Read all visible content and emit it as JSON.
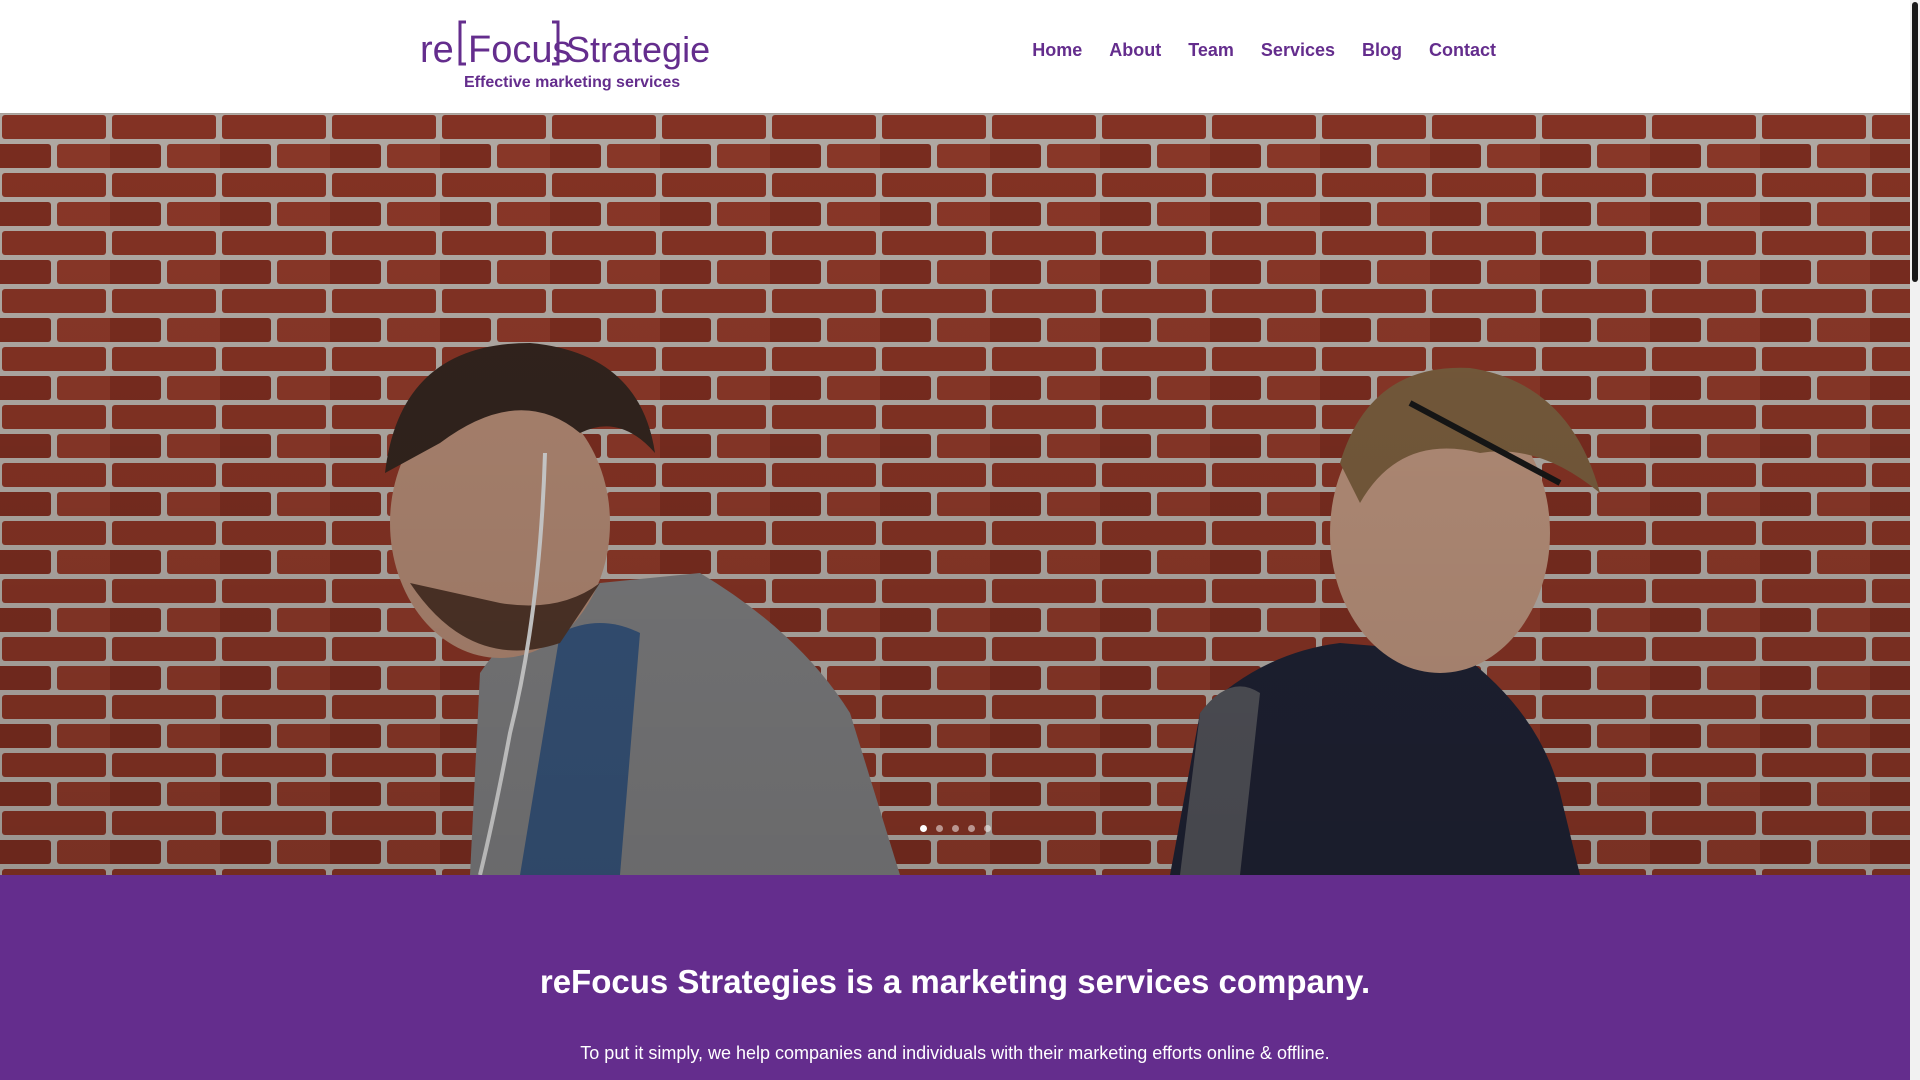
{
  "colors": {
    "brand_purple": "#642d8d",
    "nav_text": "#642d8d",
    "brick": "#8a3526",
    "white": "#ffffff"
  },
  "header": {
    "logo": {
      "text_re": "re",
      "text_focus": "Focus",
      "text_strategies": "Strategies",
      "tagline": "Effective marketing services"
    },
    "nav": [
      {
        "label": "Home"
      },
      {
        "label": "About"
      },
      {
        "label": "Team"
      },
      {
        "label": "Services"
      },
      {
        "label": "Blog"
      },
      {
        "label": "Contact"
      }
    ]
  },
  "hero": {
    "slides_total": 5,
    "active_slide": 1,
    "image_description_icon": "photo"
  },
  "intro": {
    "heading": "reFocus Strategies is a marketing services company.",
    "body": "To put it simply, we help companies and individuals with their marketing efforts online & offline."
  }
}
